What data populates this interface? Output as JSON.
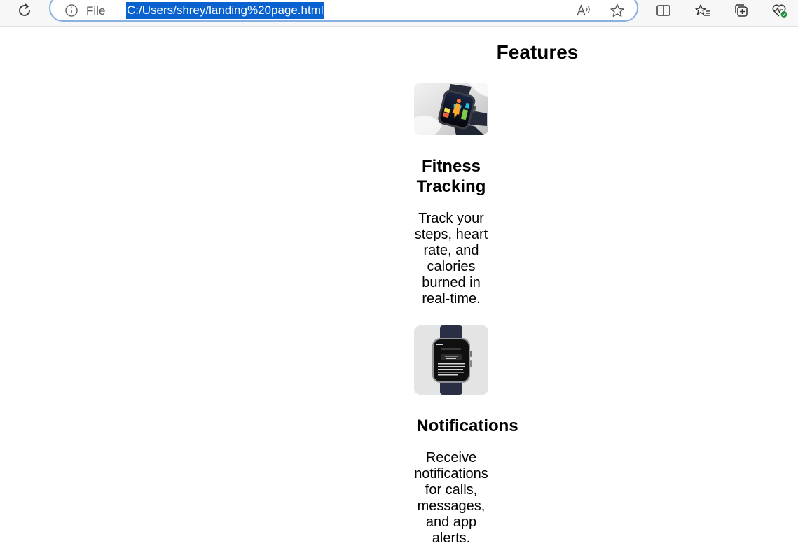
{
  "browser": {
    "scheme_label": "File",
    "url": "C:/Users/shrey/landing%20page.html"
  },
  "page": {
    "features_title": "Features",
    "features": [
      {
        "title": "Fitness Tracking",
        "description": "Track your steps, heart rate, and calories burned in real-time.",
        "image_label": "smartwatch-fitness-image"
      },
      {
        "title": "Notifications",
        "description": "Receive notifications for calls, messages, and app alerts.",
        "image_label": "smartwatch-notifications-image"
      }
    ]
  }
}
